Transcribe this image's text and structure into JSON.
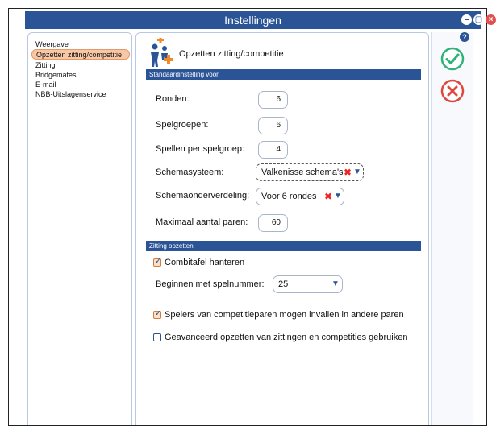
{
  "window": {
    "title": "Instellingen",
    "help_label": "?"
  },
  "sidebar": {
    "items": [
      {
        "label": "Weergave"
      },
      {
        "label": "Opzetten zitting/competitie"
      },
      {
        "label": "Zitting"
      },
      {
        "label": "Bridgemates"
      },
      {
        "label": "E-mail"
      },
      {
        "label": "NBB-Uitslagenservice"
      }
    ],
    "active_index": 1
  },
  "main": {
    "title": "Opzetten zitting/competitie",
    "standard_section": {
      "header": "Standaardinstelling voor",
      "rounds_label": "Ronden:",
      "rounds_value": "6",
      "groups_label": "Spelgroepen:",
      "groups_value": "6",
      "games_per_group_label": "Spellen per spelgroep:",
      "games_per_group_value": "4",
      "schema_system_label": "Schemasysteem:",
      "schema_system_value": "Valkenisse schema's",
      "schema_division_label": "Schemaonderverdeling:",
      "schema_division_value": "Voor 6 rondes",
      "max_pairs_label": "Maximaal aantal paren:",
      "max_pairs_value": "60"
    },
    "session_section": {
      "header": "Zitting opzetten",
      "combitafel_label": "Combitafel hanteren",
      "combitafel_checked": true,
      "start_game_label": "Beginnen met spelnummer:",
      "start_game_value": "25",
      "players_substitute_label": "Spelers van competitieparen mogen invallen in andere paren",
      "players_substitute_checked": true,
      "advanced_label": "Geavanceerd opzetten van zittingen en competities gebruiken",
      "advanced_checked": false
    }
  },
  "colors": {
    "titlebar": "#2b5497",
    "section_bar": "#2b5497",
    "active_item": "#f7c7a6",
    "ok_green": "#2fb37a",
    "cancel_red": "#e0473f"
  },
  "icons": {
    "ok": "check-circle-icon",
    "cancel": "x-circle-icon",
    "help": "question-icon",
    "section": "people-plus-icon"
  }
}
